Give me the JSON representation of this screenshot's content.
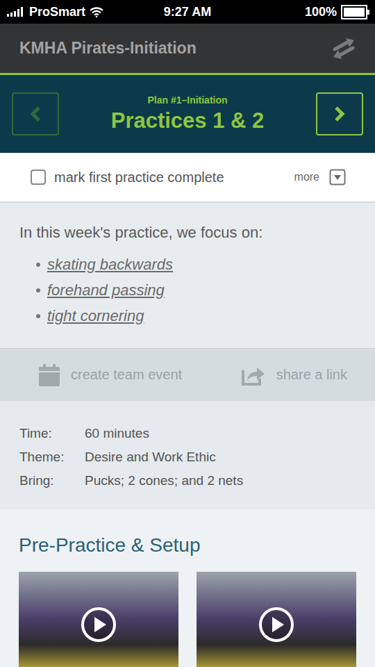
{
  "status_bar": {
    "carrier": "ProSmart",
    "time": "9:27 AM",
    "battery": {
      "reading": "100%",
      "level": 1
    }
  },
  "header": {
    "title": "KMHA Pirates-Initiation"
  },
  "nav": {
    "subtitle": "Plan #1–Initiation",
    "title": "Practices 1 & 2",
    "prev": {
      "disabled": true
    },
    "next": {
      "disabled": false
    }
  },
  "complete": {
    "label": "mark first practice complete",
    "checked": false,
    "more": "more"
  },
  "focus": {
    "intro": "In this week's practice, we focus on:",
    "items": [
      "skating backwards",
      "forehand passing",
      "tight cornering"
    ]
  },
  "actions": [
    {
      "kind": "calendar",
      "label": "create team event"
    },
    {
      "kind": "share",
      "label": "share a link"
    }
  ],
  "info": [
    {
      "label": "Time:",
      "value": "60 minutes"
    },
    {
      "label": "Theme:",
      "value": "Desire and Work Ethic"
    },
    {
      "label": "Bring:",
      "value": "Pucks; 2 cones; and 2 nets"
    }
  ],
  "section": {
    "title": "Pre-Practice & Setup",
    "thumbnails": [
      {
        "kind": "video"
      },
      {
        "kind": "video"
      }
    ]
  }
}
